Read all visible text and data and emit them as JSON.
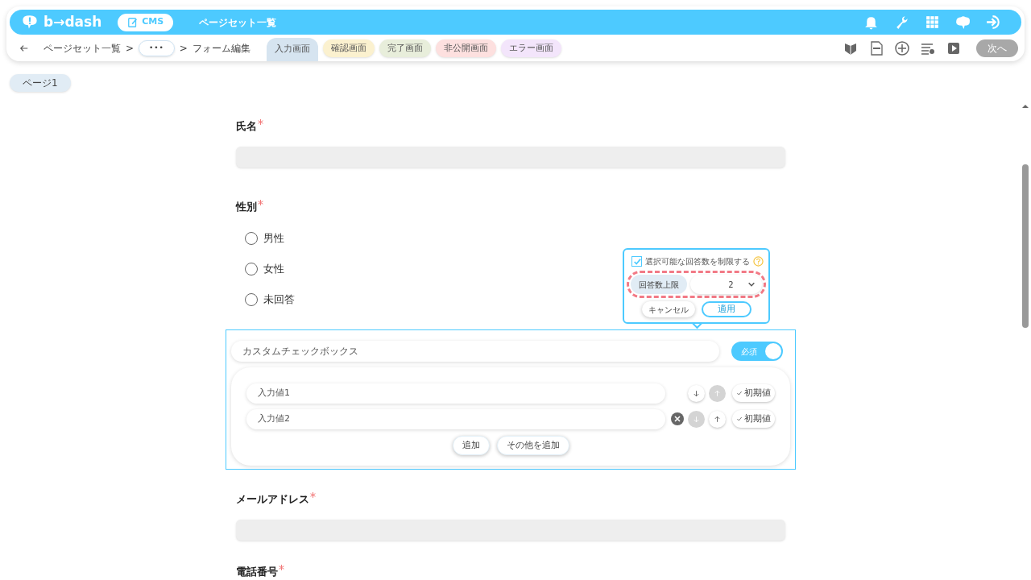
{
  "header": {
    "logo": "b→dash",
    "cms_button": "CMS",
    "title": "ページセット一覧"
  },
  "breadcrumb": [
    {
      "kind": "back"
    },
    {
      "kind": "link",
      "label": "ページセット一覧"
    },
    {
      "kind": "sep",
      "label": ">"
    },
    {
      "kind": "more",
      "label": "•••"
    },
    {
      "kind": "sep",
      "label": ">"
    },
    {
      "kind": "text",
      "label": "フォーム編集"
    }
  ],
  "tabs": [
    {
      "label": "入力画面",
      "selected": true,
      "color": "#d6e4f0"
    },
    {
      "label": "確認画面",
      "selected": false,
      "color": "#fbf1cf"
    },
    {
      "label": "完了画面",
      "selected": false,
      "color": "#e8eedb"
    },
    {
      "label": "非公開画面",
      "selected": false,
      "color": "#fde0df"
    },
    {
      "label": "エラー画面",
      "selected": false,
      "color": "#f3e5fb"
    }
  ],
  "next_button": {
    "label": "次へ",
    "disabled": true
  },
  "page_tab": "ページ1",
  "fields": [
    {
      "kind": "text",
      "label": "氏名",
      "required": true
    },
    {
      "kind": "radio",
      "label": "性別",
      "required": true,
      "options": [
        {
          "label": "男性",
          "selected": false
        },
        {
          "label": "女性",
          "selected": false
        },
        {
          "label": "未回答",
          "selected": false
        }
      ]
    },
    {
      "kind": "editor",
      "title_placeholder": "カスタムチェックボックス",
      "toggle": {
        "label": "必須",
        "on": true
      },
      "options": [
        {
          "placeholder": "入力値1",
          "removable": false,
          "down_enabled": true,
          "up_enabled": false,
          "default_label": "初期値"
        },
        {
          "placeholder": "入力値2",
          "removable": true,
          "down_enabled": false,
          "up_enabled": true,
          "default_label": "初期値"
        }
      ],
      "buttons": [
        "追加",
        "その他を追加"
      ],
      "popover": {
        "checkbox_label": "選択可能な回答数を制限する",
        "checked": true,
        "limit_label": "回答数上限",
        "limit_value": "2",
        "cancel": "キャンセル",
        "apply": "適用"
      }
    },
    {
      "kind": "text",
      "label": "メールアドレス",
      "required": true
    },
    {
      "kind": "text",
      "label": "電話番号",
      "required": true
    }
  ]
}
